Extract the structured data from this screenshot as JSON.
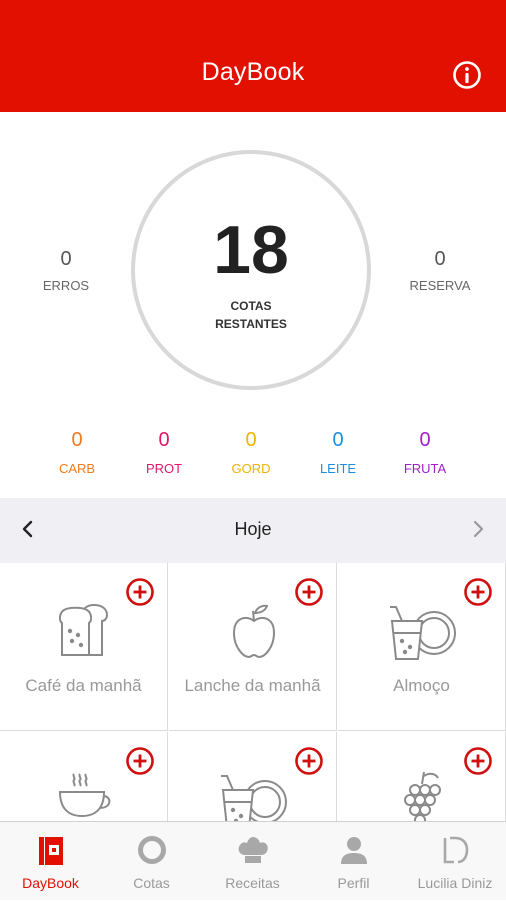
{
  "header": {
    "title": "DayBook"
  },
  "summary": {
    "cotas_value": "18",
    "cotas_label_line1": "COTAS",
    "cotas_label_line2": "RESTANTES",
    "erros_value": "0",
    "erros_label": "ERROS",
    "reserva_value": "0",
    "reserva_label": "RESERVA"
  },
  "macros": [
    {
      "value": "0",
      "label": "CARB",
      "color": "#f07a1e"
    },
    {
      "value": "0",
      "label": "PROT",
      "color": "#e0186c"
    },
    {
      "value": "0",
      "label": "GORD",
      "color": "#f0b400"
    },
    {
      "value": "0",
      "label": "LEITE",
      "color": "#1a8fe0"
    },
    {
      "value": "0",
      "label": "FRUTA",
      "color": "#a020c8"
    }
  ],
  "day_nav": {
    "label": "Hoje"
  },
  "meals": [
    {
      "label": "Café da manhã",
      "icon": "toast-icon"
    },
    {
      "label": "Lanche da manhã",
      "icon": "apple-icon"
    },
    {
      "label": "Almoço",
      "icon": "drink-plate-icon"
    },
    {
      "label": "",
      "icon": "coffee-cup-icon"
    },
    {
      "label": "",
      "icon": "drink-plate-icon"
    },
    {
      "label": "",
      "icon": "grapes-icon"
    }
  ],
  "tabs": [
    {
      "label": "DayBook",
      "icon": "daybook-icon",
      "active": true
    },
    {
      "label": "Cotas",
      "icon": "ring-icon",
      "active": false
    },
    {
      "label": "Receitas",
      "icon": "chef-hat-icon",
      "active": false
    },
    {
      "label": "Perfil",
      "icon": "person-icon",
      "active": false
    },
    {
      "label": "Lucilia Diniz",
      "icon": "ld-logo-icon",
      "active": false
    }
  ],
  "colors": {
    "brand": "#e21000",
    "add": "#d10f0f"
  }
}
